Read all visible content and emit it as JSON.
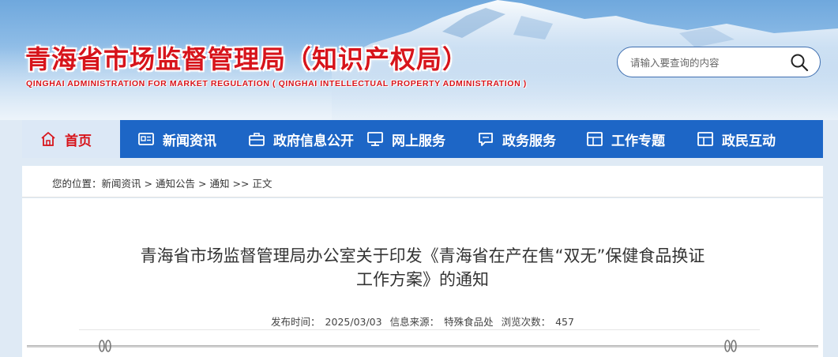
{
  "header": {
    "title": "青海省市场监督管理局（知识产权局）",
    "subtitle": "QINGHAI ADMINISTRATION FOR MARKET REGULATION ( QINGHAI INTELLECTUAL PROPERTY ADMINISTRATION )",
    "search": {
      "placeholder": "请输入要查询的内容",
      "icon": "search-icon"
    }
  },
  "nav": {
    "items": [
      {
        "label": "首页",
        "icon": "home-icon",
        "active": true
      },
      {
        "label": "新闻资讯",
        "icon": "news-icon"
      },
      {
        "label": "政府信息公开",
        "icon": "briefcase-icon"
      },
      {
        "label": "网上服务",
        "icon": "monitor-icon"
      },
      {
        "label": "政务服务",
        "icon": "chat-icon"
      },
      {
        "label": "工作专题",
        "icon": "window-icon"
      },
      {
        "label": "政民互动",
        "icon": "window-icon"
      }
    ]
  },
  "breadcrumb": {
    "prefix": "您的位置：",
    "items": [
      "新闻资讯",
      "通知公告",
      "通知",
      "正文"
    ],
    "separators": [
      ">",
      ">",
      ">>"
    ]
  },
  "article": {
    "title_line1": "青海省市场监督管理局办公室关于印发《青海省在产在售“双无”保健食品换证",
    "title_line2": "工作方案》的通知",
    "meta": {
      "date_label": "发布时间：",
      "date": "2025/03/03",
      "source_label": "信息来源：",
      "source": "特殊食品处",
      "views_label": "浏览次数：",
      "views": "457"
    }
  },
  "colors": {
    "brand_red": "#d7141b",
    "nav_blue": "#1d66c6",
    "active_bg": "#dce8f6"
  }
}
